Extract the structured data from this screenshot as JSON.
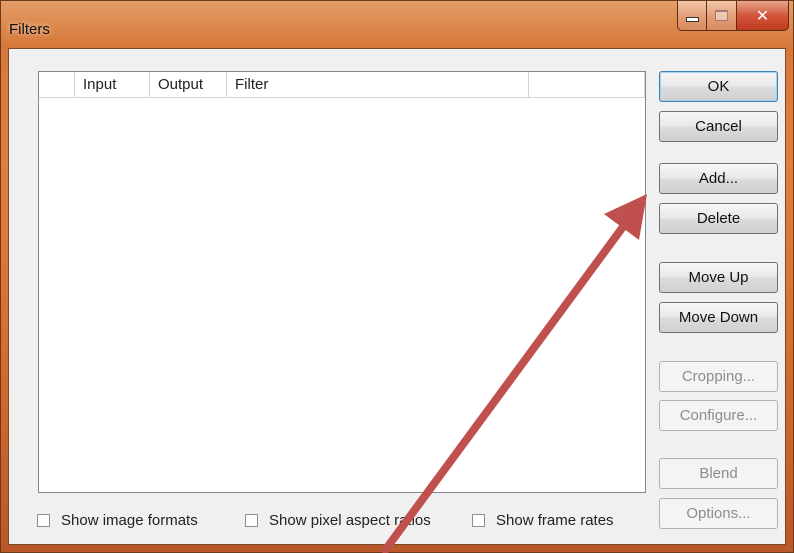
{
  "window": {
    "title": "Filters"
  },
  "list": {
    "columns": [
      "",
      "Input",
      "Output",
      "Filter",
      ""
    ]
  },
  "buttons": {
    "ok": "OK",
    "cancel": "Cancel",
    "add": "Add...",
    "delete": "Delete",
    "move_up": "Move Up",
    "move_down": "Move Down",
    "cropping": "Cropping...",
    "configure": "Configure...",
    "blend": "Blend",
    "options": "Options..."
  },
  "checkboxes": {
    "show_image_formats": "Show image formats",
    "show_pixel_aspect_ratios": "Show pixel aspect ratios",
    "show_frame_rates": "Show frame rates"
  },
  "colors": {
    "annotation_arrow": "#c0504d",
    "accent": "#3c7fb1"
  },
  "icons": {
    "minimize": "minimize-icon",
    "maximize": "maximize-icon",
    "close": "close-icon",
    "annotation": "arrow-icon"
  }
}
